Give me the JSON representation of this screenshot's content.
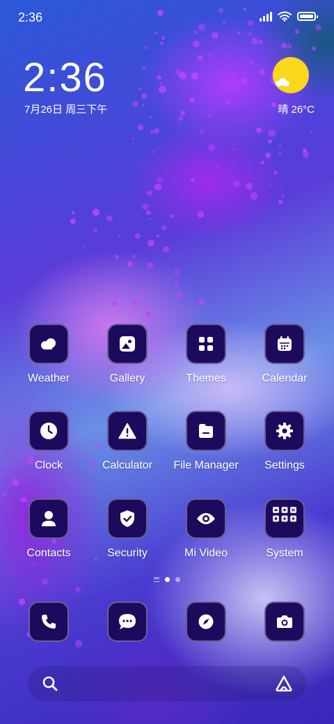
{
  "status_bar": {
    "time": "2:36",
    "icons": [
      "signal-icon",
      "wifi-icon",
      "battery-icon"
    ]
  },
  "clock_widget": {
    "time": "2:36",
    "date": "7月26日 周三下午"
  },
  "weather_widget": {
    "text": "晴 26°C",
    "icon": "sunny-partly-cloudy-icon"
  },
  "apps": [
    {
      "label": "Weather",
      "icon": "weather-cloud-icon"
    },
    {
      "label": "Gallery",
      "icon": "gallery-icon"
    },
    {
      "label": "Themes",
      "icon": "themes-grid-icon"
    },
    {
      "label": "Calendar",
      "icon": "calendar-icon"
    },
    {
      "label": "Clock",
      "icon": "clock-icon"
    },
    {
      "label": "Calculator",
      "icon": "calculator-warning-icon"
    },
    {
      "label": "File Manager",
      "icon": "folder-icon"
    },
    {
      "label": "Settings",
      "icon": "gear-icon"
    },
    {
      "label": "Contacts",
      "icon": "contact-person-icon"
    },
    {
      "label": "Security",
      "icon": "shield-check-icon"
    },
    {
      "label": "Mi Video",
      "icon": "eye-icon"
    },
    {
      "label": "System",
      "icon": "folder-grid-icon"
    }
  ],
  "dock": [
    {
      "icon": "phone-icon"
    },
    {
      "icon": "message-bubble-icon"
    },
    {
      "icon": "compass-icon"
    },
    {
      "icon": "camera-icon"
    }
  ],
  "page_indicator": {
    "pages": 2,
    "current": 1
  },
  "search_bar": {
    "left_icon": "search-icon",
    "right_icon": "assistant-icon"
  },
  "colors": {
    "icon_background": "#1c0a5c",
    "sun": "#f9d71c",
    "text": "#ffffff"
  }
}
